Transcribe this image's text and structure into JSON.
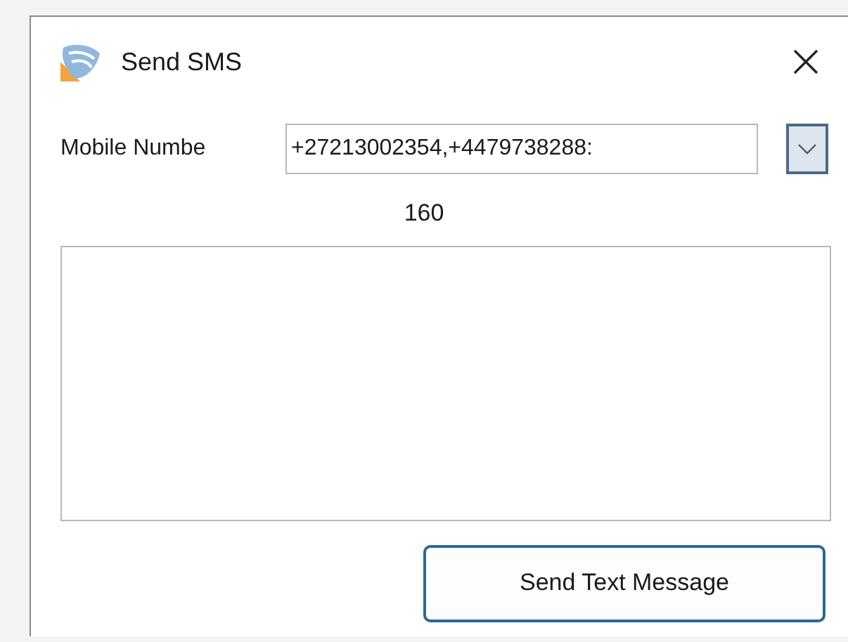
{
  "window": {
    "title": "Send SMS"
  },
  "mobile_number": {
    "label": "Mobile Numbe",
    "value": "+27213002354,+4479738288:"
  },
  "char_count": "160",
  "send_button": "Send Text Message"
}
